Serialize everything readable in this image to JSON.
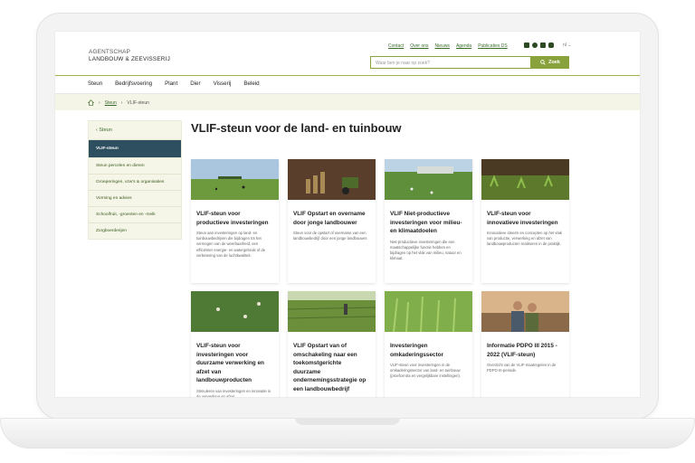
{
  "logo": {
    "line1": "AGENTSCHAP",
    "line2": "LANDBOUW & ZEEVISSERIJ"
  },
  "toplinks": [
    "Contact",
    "Over ons",
    "Nieuws",
    "Agenda",
    "Publicaties DS"
  ],
  "language": "nl",
  "search": {
    "placeholder": "Waar ben je naar op zoek?",
    "button_label": "Zoek"
  },
  "nav": [
    "Steun",
    "Bedrijfsvoering",
    "Plant",
    "Dier",
    "Visserij",
    "Beleid"
  ],
  "breadcrumb": {
    "items": [
      "Steun",
      "VLIF-steun"
    ]
  },
  "sidebar": {
    "back_label": "Steun",
    "items": [
      {
        "label": "VLIF-steun",
        "active": true
      },
      {
        "label": "Steun percelen en dieren",
        "active": false
      },
      {
        "label": "Groeperingen, vzw's & organisaties",
        "active": false
      },
      {
        "label": "Vorming en advies",
        "active": false
      },
      {
        "label": "Schoolfruit, -groenten en -melk",
        "active": false
      },
      {
        "label": "Zorgboerderijen",
        "active": false
      }
    ]
  },
  "page_title": "VLIF-steun voor de land- en tuinbouw",
  "cards": [
    {
      "title": "VLIF-steun voor productieve investeringen",
      "desc": "Steun aan investeringen op land- en tuinbouwbedrijven die bijdragen tot het vermogen van de weerbaarheid, een efficiënter energie- en watergebruik of de verbetering van de luchtkwaliteit."
    },
    {
      "title": "VLIF Opstart en overname door jonge landbouwer",
      "desc": "Steun voor de opstart of overname van een landbouwbedrijf door een jonge landbouwer."
    },
    {
      "title": "VLIF Niet-productieve investeringen voor milieu- en klimaatdoelen",
      "desc": "Niet-productieve investeringen die een maatschappelijke functie hebben en bijdragen op het vlak van milieu, natuur en klimaat."
    },
    {
      "title": "VLIF-steun voor innovatieve investeringen",
      "desc": "Innovatieve ideeën en concepten op het vlak van productie, verwerking en afzet van landbouwproducten realiseren in de praktijk."
    },
    {
      "title": "VLIF-steun voor investeringen voor duurzame verwerking en afzet van landbouwproducten",
      "desc": "Stimuleren van investeringen en innovatie in de verwerking en afzet"
    },
    {
      "title": "VLIF Opstart van of omschakeling naar een toekomstgerichte duurzame ondernemingsstrategie op een landbouwbedrijf",
      "desc": ""
    },
    {
      "title": "Investeringen omkaderingssector",
      "desc": "VLIF-steun voor investeringen in de omkaderingssector van land- en tuinbouw (proefcentra en vergelijkbare instellingen)."
    },
    {
      "title": "Informatie PDPO III 2015 - 2022 (VLIF-steun)",
      "desc": "Overzicht van de VLIF-maatregelen in de PDPO III-periode."
    }
  ],
  "colors": {
    "accent_green": "#8aa23b",
    "sidebar_active": "#2d4f5f",
    "link_green": "#3a6b2a"
  }
}
